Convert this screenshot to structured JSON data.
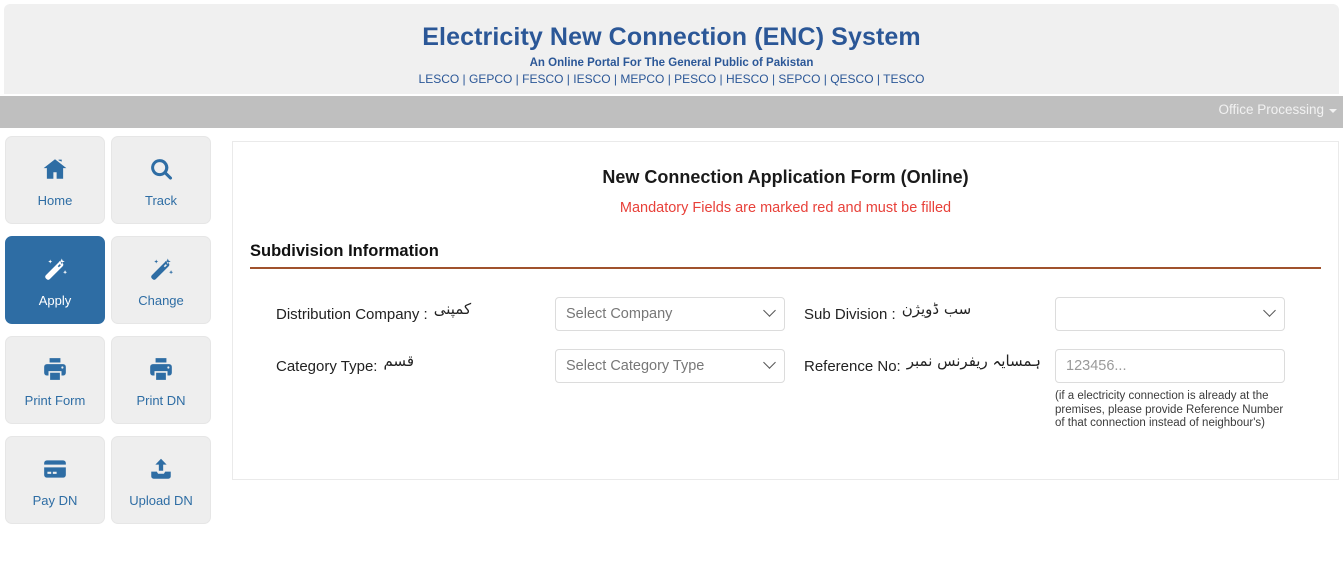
{
  "header": {
    "title": "Electricity New Connection (ENC) System",
    "subtitle": "An Online Portal For The General Public of Pakistan",
    "discos": "LESCO | GEPCO | FESCO | IESCO | MEPCO | PESCO | HESCO | SEPCO | QESCO | TESCO",
    "title_color": "#2b5797"
  },
  "navbar": {
    "right_item": "Office Processing",
    "background": "#bfbfbf"
  },
  "sidebar": {
    "items": [
      {
        "label": "Home",
        "icon": "home-icon",
        "active": false
      },
      {
        "label": "Track",
        "icon": "search-icon",
        "active": false
      },
      {
        "label": "Apply",
        "icon": "magic-wand-icon",
        "active": true
      },
      {
        "label": "Change",
        "icon": "magic-wand-icon",
        "active": false
      },
      {
        "label": "Print Form",
        "icon": "printer-icon",
        "active": false
      },
      {
        "label": "Print DN",
        "icon": "printer-icon",
        "active": false
      },
      {
        "label": "Pay DN",
        "icon": "credit-card-icon",
        "active": false
      },
      {
        "label": "Upload DN",
        "icon": "upload-icon",
        "active": false
      }
    ],
    "active_color": "#2e6da4",
    "tile_color": "#eeeeee"
  },
  "form": {
    "title": "New Connection Application Form (Online)",
    "note": "Mandatory Fields are marked red and must be filled",
    "note_color": "#e8413a",
    "section_title": "Subdivision Information",
    "section_rule_color": "#a0522d",
    "fields": {
      "distribution_company": {
        "label_en": "Distribution Company :",
        "label_ur": "کمپنی",
        "value": "Select Company"
      },
      "category_type": {
        "label_en": "Category Type:",
        "label_ur": "قسم",
        "value": "Select Category Type"
      },
      "sub_division": {
        "label_en": "Sub Division :",
        "label_ur": "سب ڈویژن",
        "value": ""
      },
      "reference_no": {
        "label_en": "Reference No:",
        "label_ur": "ہمسایہ ریفرنس نمبر",
        "value": "",
        "placeholder": "123456...",
        "hint": "(if a electricity connection is already at the premises, please provide Reference Number of that connection instead of neighbour's)"
      }
    }
  }
}
